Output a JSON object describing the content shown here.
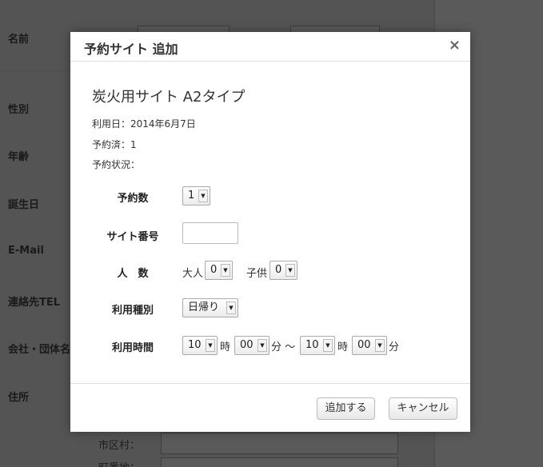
{
  "background_form": {
    "labels": [
      "名前",
      "性別",
      "年齢",
      "誕生日",
      "E-Mail",
      "連絡先TEL",
      "会社・団体名",
      "住所"
    ],
    "sublabels": [
      "市区村：",
      "町番地："
    ]
  },
  "modal": {
    "title": "予約サイト 追加",
    "close_icon": "×",
    "site_name": "炭火用サイト A2タイプ",
    "use_date": "利用日：2014年6月7日",
    "reserved": "予約済：1",
    "status": "予約状況：",
    "fields": {
      "count_label": "予約数",
      "count_value": "1",
      "site_number_label": "サイト番号",
      "people_label": "人　数",
      "adult_label": "大人",
      "adult_value": "0",
      "child_label": "子供",
      "child_value": "0",
      "usage_type_label": "利用種別",
      "usage_type_value": "日帰り",
      "time_label": "利用時間",
      "start_hour": "10",
      "hour_unit": "時",
      "start_minute": "00",
      "minute_unit_tilde": "分 〜",
      "end_hour": "10",
      "hour_unit_2": "時",
      "end_minute": "00",
      "minute_unit": "分"
    },
    "buttons": {
      "add": "追加する",
      "cancel": "キャンセル"
    }
  }
}
